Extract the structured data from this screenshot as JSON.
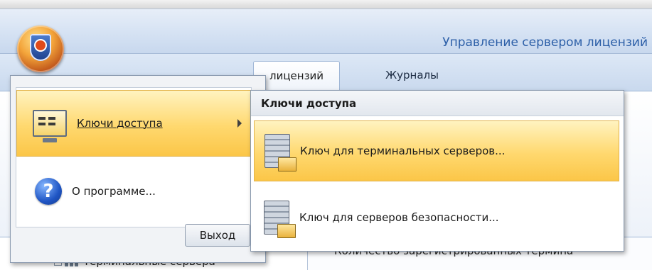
{
  "window": {
    "title": "Управление сервером лицензий"
  },
  "ribbon": {
    "tabs": [
      {
        "label": "лицензий"
      },
      {
        "label": "Журналы"
      }
    ]
  },
  "app_menu": {
    "items": [
      {
        "label": "Ключи доступа",
        "icon": "keys-monitor-icon",
        "highlighted": true,
        "has_submenu": true
      },
      {
        "label": "О программе...",
        "icon": "help-icon"
      }
    ],
    "exit_label": "Выход"
  },
  "submenu": {
    "title": "Ключи доступа",
    "items": [
      {
        "label": "Ключ для терминальных серверов...",
        "icon": "server-key-icon",
        "highlighted": true
      },
      {
        "label": "Ключ для серверов безопасности...",
        "icon": "server-key-icon"
      }
    ]
  },
  "content": {
    "count_label": "Количество зарегистрированных термина",
    "tree_item": "Терминальные сервера"
  },
  "colors": {
    "highlight": "#ffd86e",
    "title_text": "#2b5ea7"
  }
}
